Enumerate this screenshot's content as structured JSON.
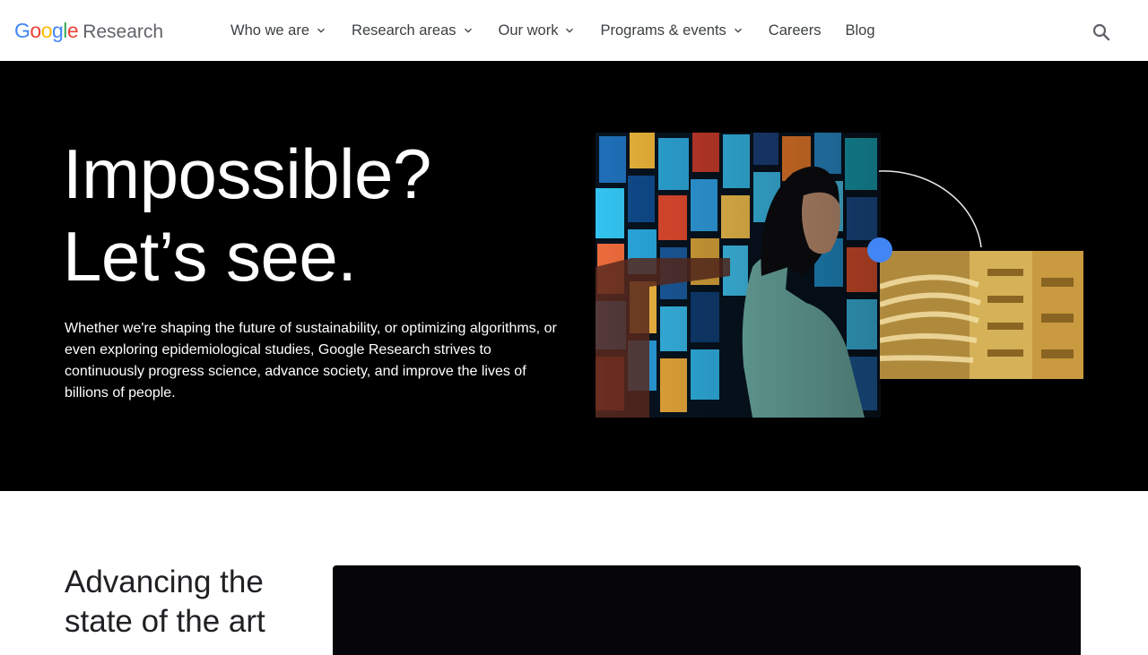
{
  "header": {
    "logo_google": "Google",
    "logo_product": "Research",
    "nav": [
      {
        "label": "Who we are",
        "has_dropdown": true
      },
      {
        "label": "Research areas",
        "has_dropdown": true
      },
      {
        "label": "Our work",
        "has_dropdown": true
      },
      {
        "label": "Programs & events",
        "has_dropdown": true
      },
      {
        "label": "Careers",
        "has_dropdown": false
      },
      {
        "label": "Blog",
        "has_dropdown": false
      }
    ],
    "search_icon": "search-icon"
  },
  "hero": {
    "title_line1": "Impossible?",
    "title_line2": "Let’s see.",
    "body": "Whether we're shaping the future of sustainability, or optimizing algorithms, or even exploring epidemiological studies, Google Research strives to continuously progress science, advance society, and improve the lives of billions of people."
  },
  "section2": {
    "title": "Advancing the state of the art"
  },
  "colors": {
    "hero_bg": "#000000",
    "nav_text": "#3c4043",
    "accent_blue": "#4285f4",
    "google_blue": "#4285F4",
    "google_red": "#EA4335",
    "google_yellow": "#FBBC05",
    "google_green": "#34A853"
  }
}
